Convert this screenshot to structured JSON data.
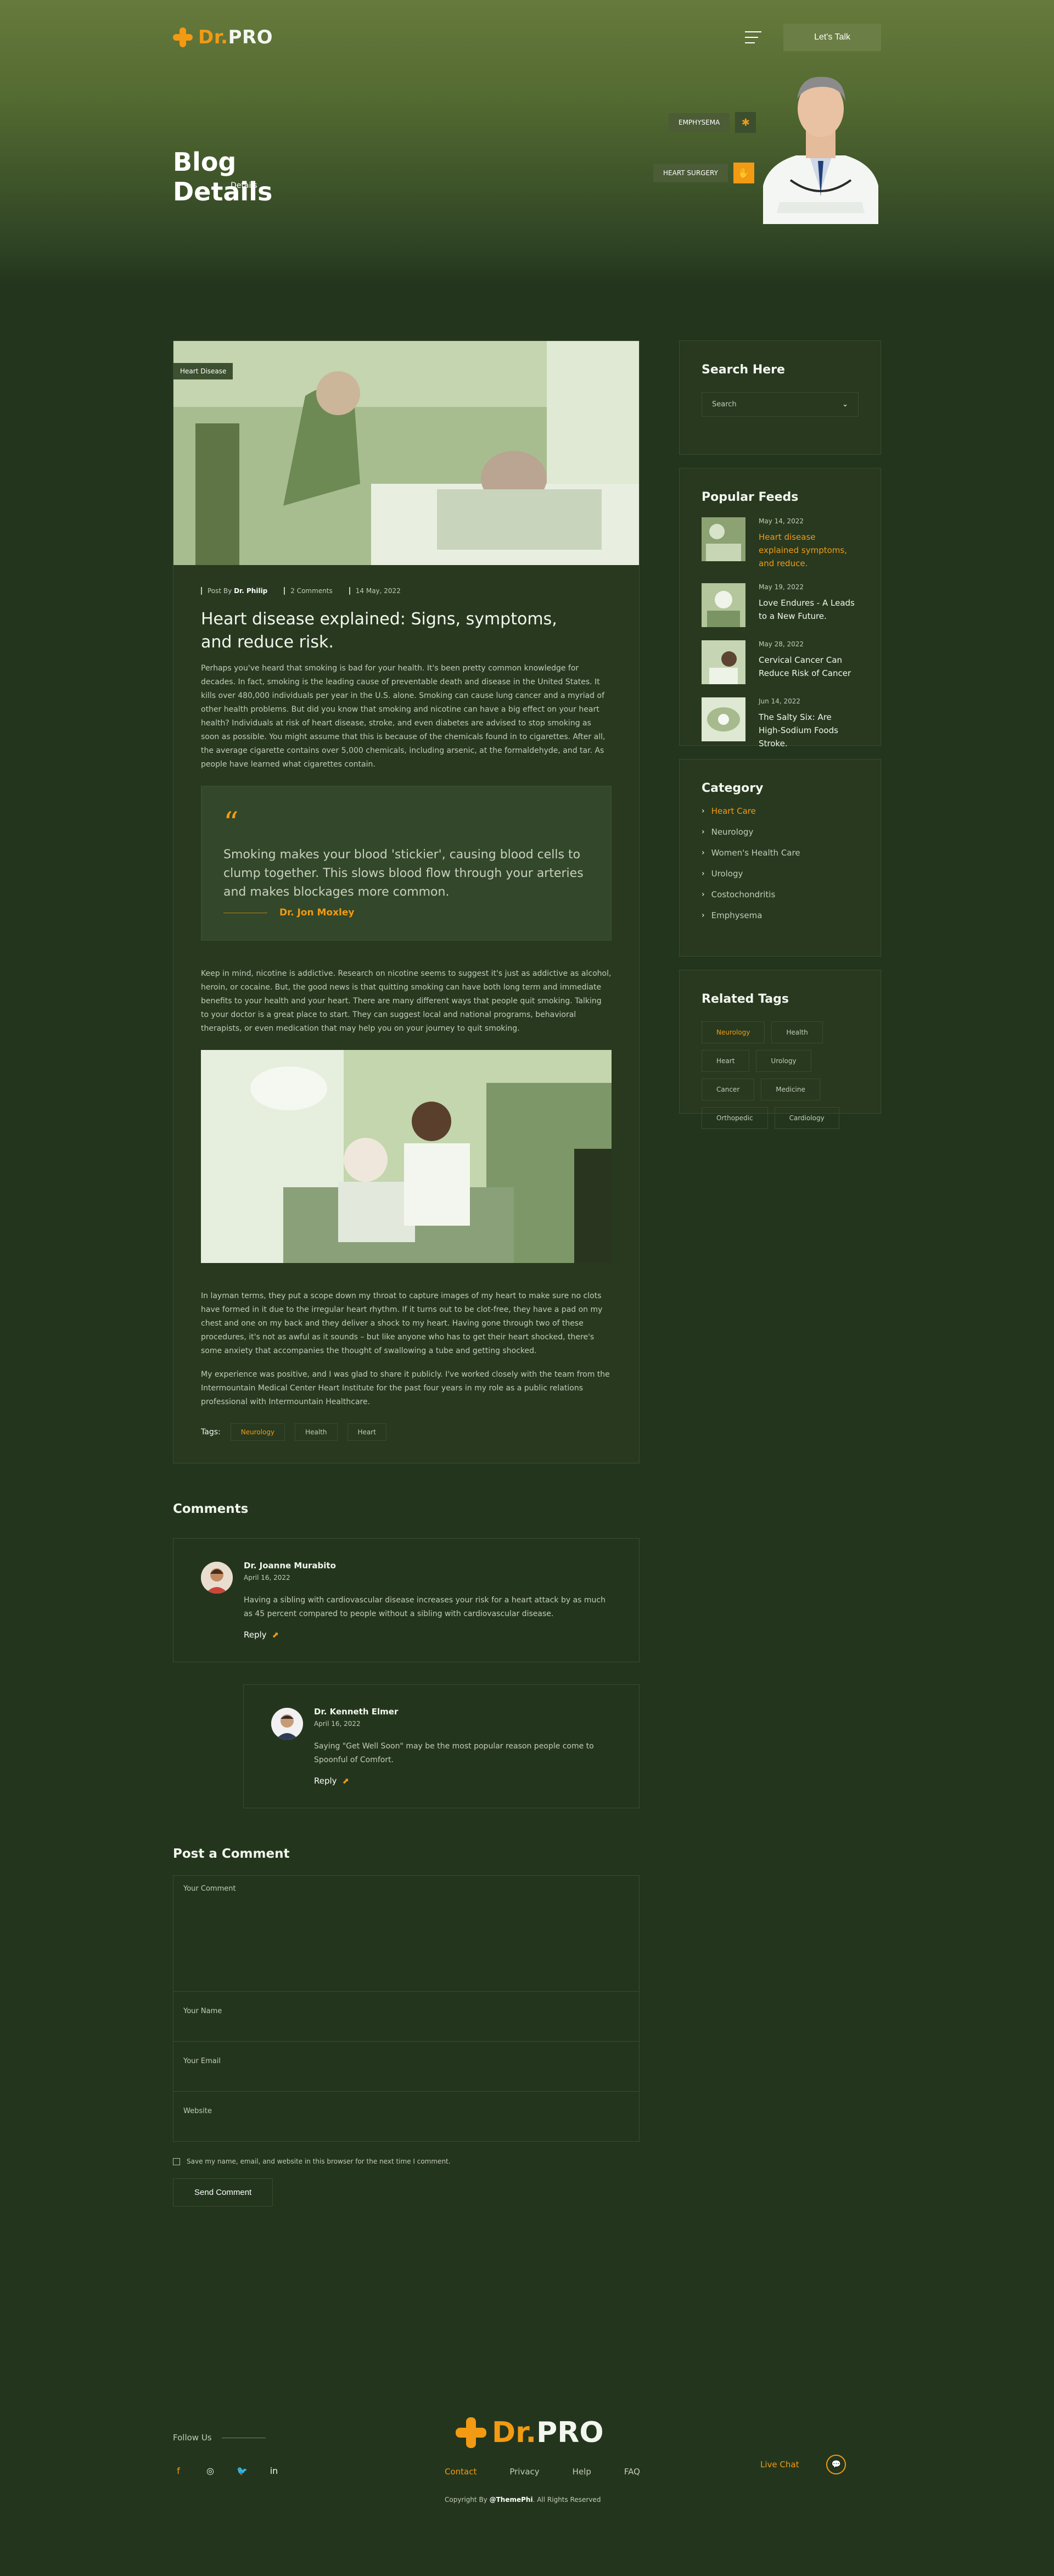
{
  "brand": {
    "logo_prefix": "Dr",
    "logo_dot": ".",
    "logo_suffix": "PRO"
  },
  "header": {
    "cta_label": "Let's Talk"
  },
  "hero": {
    "title_line1": "Blog",
    "title_line2": "Details",
    "breadcrumb": "Details",
    "badge_top": "EMPHYSEMA",
    "badge_bottom": "HEART SURGERY"
  },
  "post": {
    "image_tag": "Heart Disease",
    "meta_author_label": "Post By",
    "meta_author": "Dr. Philip",
    "meta_comments": "2 Comments",
    "meta_date": "14 May, 2022",
    "title": "Heart disease explained: Signs, symptoms, and reduce risk.",
    "para1": "Perhaps you've heard that smoking is bad for your health. It's been pretty common knowledge for decades. In fact, smoking is the leading cause of preventable death and disease in the United States. It kills over 480,000 individuals per year in the U.S. alone. Smoking can cause lung cancer and a myriad of other health problems. But did you know that smoking and nicotine can have a big effect on your heart health? Individuals at risk of heart disease, stroke, and even diabetes are advised to stop smoking as soon as possible. You might assume that this is because of the chemicals found in to cigarettes. After all, the average cigarette contains over 5,000 chemicals, including arsenic, at the formaldehyde, and tar. As people have learned what cigarettes contain.",
    "quote_text": "Smoking makes your blood 'stickier', causing blood cells to clump together. This slows blood flow through your arteries and makes blockages more common.",
    "quote_author": "Dr. Jon Moxley",
    "para2": "Keep in mind, nicotine is addictive. Research on nicotine seems to suggest it's just as addictive as alcohol, heroin, or cocaine. But, the good news is that quitting smoking can have both long term and immediate benefits to your health and your heart. There are many different ways that people quit smoking. Talking to your doctor is a great place to start. They can suggest local and national programs, behavioral therapists, or even medication that may help you on your journey to quit smoking.",
    "para3": "In layman terms, they put a scope down my throat to capture images of my heart to make sure no clots have formed in it due to the irregular heart rhythm. If it turns out to be clot-free, they have a pad on my chest and one on my back and they deliver a shock to my heart. Having gone through two of these procedures, it's not as awful as it sounds – but like anyone who has to get their heart shocked, there's some anxiety that accompanies the thought of swallowing a tube and getting shocked.",
    "para4": "My experience was positive, and I was glad to share it publicly. I've worked closely with the team from the Intermountain Medical Center Heart Institute for the past four years in my role as a public relations professional with Intermountain Healthcare.",
    "tags_label": "Tags:",
    "tags": [
      "Neurology",
      "Health",
      "Heart"
    ]
  },
  "comments": {
    "title": "Comments",
    "items": [
      {
        "name": "Dr. Joanne Murabito",
        "date": "April 16, 2022",
        "text": "Having a sibling with cardiovascular disease increases your risk for a heart attack by as much as 45 percent compared to people without a sibling with cardiovascular disease.",
        "reply": "Reply"
      },
      {
        "name": "Dr. Kenneth Elmer",
        "date": "April 16, 2022",
        "text": "Saying \"Get Well Soon\" may be the most popular reason people come to Spoonful of Comfort.",
        "reply": "Reply"
      }
    ]
  },
  "form": {
    "title": "Post a Comment",
    "comment_placeholder": "Your Comment",
    "name_placeholder": "Your Name",
    "email_placeholder": "Your Email",
    "website_placeholder": "Website",
    "save_label": "Save my name, email, and website in this browser for the next time I comment.",
    "submit_label": "Send Comment"
  },
  "sidebar": {
    "search_title": "Search Here",
    "search_placeholder": "Search",
    "feeds_title": "Popular Feeds",
    "feeds": [
      {
        "date": "May 14, 2022",
        "title": "Heart disease explained symptoms, and reduce."
      },
      {
        "date": "May 19, 2022",
        "title": "Love Endures - A Leads to a New Future."
      },
      {
        "date": "May 28, 2022",
        "title": "Cervical Cancer Can Reduce Risk of Cancer"
      },
      {
        "date": "Jun 14, 2022",
        "title": "The Salty Six: Are High-Sodium Foods Stroke."
      }
    ],
    "category_title": "Category",
    "categories": [
      "Heart Care",
      "Neurology",
      "Women's Health Care",
      "Urology",
      "Costochondritis",
      "Emphysema"
    ],
    "tags_title": "Related Tags",
    "tags": [
      "Neurology",
      "Health",
      "Heart",
      "Urology",
      "Cancer",
      "Medicine",
      "Orthopedic",
      "Cardiology"
    ]
  },
  "footer": {
    "follow_label": "Follow Us",
    "links": [
      "Contact",
      "Privacy",
      "Help",
      "FAQ"
    ],
    "copyright_prefix": "Copyright By",
    "copyright_brand": "@ThemePhi",
    "copyright_suffix": ". All Rights Reserved",
    "live_chat": "Live Chat"
  }
}
